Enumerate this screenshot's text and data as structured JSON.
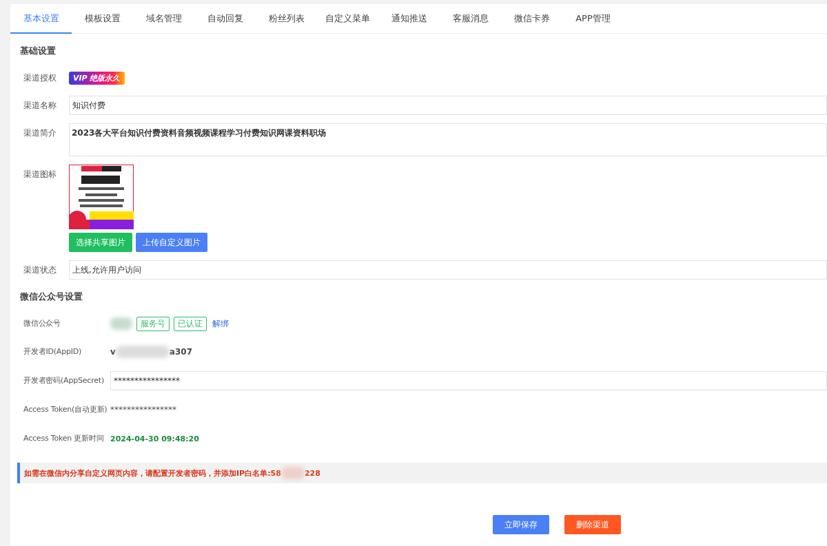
{
  "tabs": [
    {
      "label": "基本设置",
      "selected": true
    },
    {
      "label": "模板设置",
      "selected": false
    },
    {
      "label": "域名管理",
      "selected": false
    },
    {
      "label": "自动回复",
      "selected": false
    },
    {
      "label": "粉丝列表",
      "selected": false
    },
    {
      "label": "自定义菜单",
      "selected": false
    },
    {
      "label": "通知推送",
      "selected": false
    },
    {
      "label": "客服消息",
      "selected": false
    },
    {
      "label": "微信卡券",
      "selected": false
    },
    {
      "label": "APP管理",
      "selected": false
    }
  ],
  "basic": {
    "title": "基础设置",
    "auth": {
      "label": "渠道授权",
      "badge": "VIP 绝版永久"
    },
    "name": {
      "label": "渠道名称",
      "value": "知识付费"
    },
    "intro": {
      "label": "渠道简介",
      "value": "2023各大平台知识付费资料音频视频课程学习付费知识网课资料职场"
    },
    "icon": {
      "label": "渠道图标",
      "buttons": [
        "选择共享图片",
        "上传自定义图片"
      ]
    },
    "status": {
      "label": "渠道状态",
      "value": "上线,允许用户访问"
    }
  },
  "wechat": {
    "title": "微信公众号设置",
    "account": {
      "label": "微信公众号",
      "tags": [
        "服务号",
        "已认证"
      ],
      "link": "解绑"
    },
    "appid": {
      "label": "开发者ID(AppID)",
      "value_start": "v",
      "value_end": "a307"
    },
    "secret": {
      "label": "开发者密码(AppSecret)",
      "value": "****************"
    },
    "token": {
      "label": "Access Token(自动更新)",
      "value": "****************"
    },
    "updated": {
      "label": "Access Token 更新时间",
      "value": "2024-04-30 09:48:20"
    }
  },
  "notice": {
    "text_start": "如需在微信内分享自定义网页内容，请配置开发者密码，并添加IP白名单:58",
    "text_end": "228"
  },
  "actions": [
    {
      "label": "立即保存",
      "kind": "primary"
    },
    {
      "label": "删除渠道",
      "kind": "danger"
    }
  ]
}
